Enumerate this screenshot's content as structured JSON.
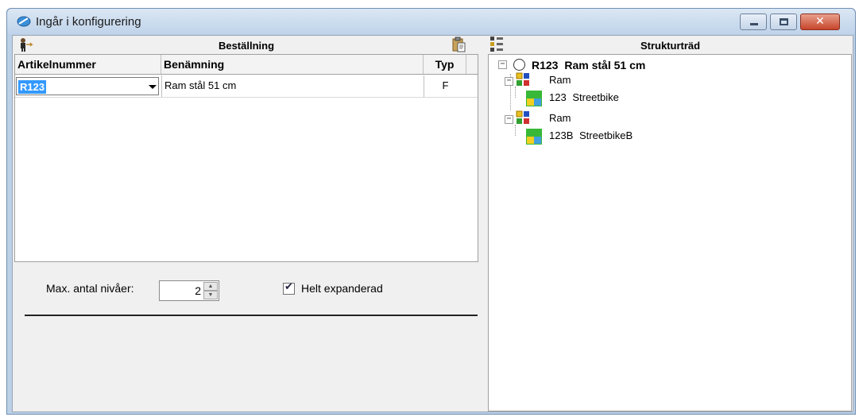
{
  "window": {
    "title": "Ingår i konfigurering",
    "close_glyph": "✕"
  },
  "left_panel": {
    "title": "Beställning",
    "grid": {
      "columns": [
        "Artikelnummer",
        "Benämning",
        "Typ"
      ],
      "rows": [
        {
          "artikelnummer": "R123",
          "benamning": "Ram stål 51 cm",
          "typ": "F"
        }
      ]
    },
    "levels_label": "Max. antal nivåer:",
    "levels_value": "2",
    "expand_checkbox": {
      "label": "Helt expanderad",
      "checked": true,
      "check_glyph": "✔"
    }
  },
  "right_panel": {
    "title": "Strukturträd",
    "tree": {
      "root": {
        "code": "R123",
        "name": "Ram stål 51 cm"
      },
      "children": [
        {
          "label": "Ram",
          "child": {
            "code": "123",
            "name": "Streetbike"
          }
        },
        {
          "label": "Ram",
          "child": {
            "code": "123B",
            "name": "StreetbikeB"
          }
        }
      ]
    }
  },
  "colors": {
    "selection": "#3399ff",
    "close_button": "#c7452b"
  }
}
